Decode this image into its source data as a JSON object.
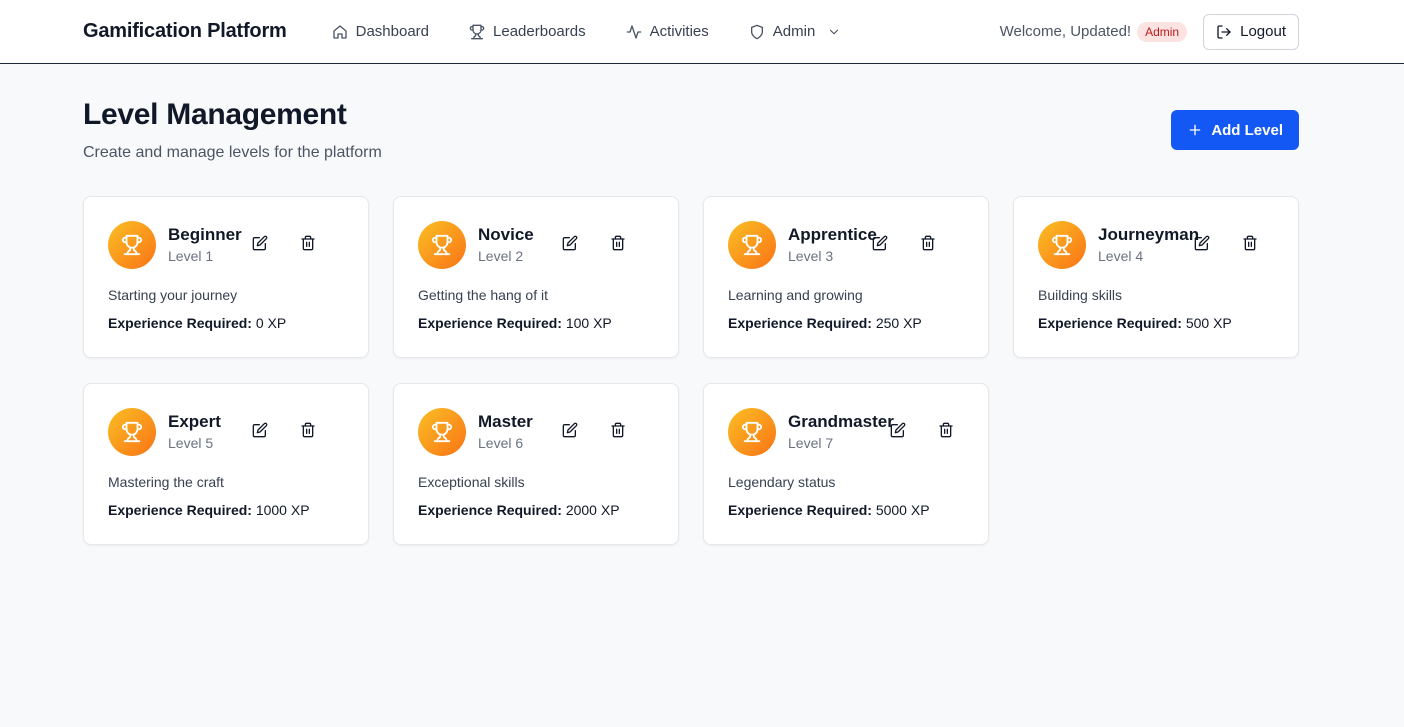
{
  "app": {
    "title": "Gamification Platform"
  },
  "nav": {
    "items": [
      {
        "label": "Dashboard",
        "icon": "home-icon"
      },
      {
        "label": "Leaderboards",
        "icon": "trophy-icon"
      },
      {
        "label": "Activities",
        "icon": "activity-icon"
      },
      {
        "label": "Admin",
        "icon": "shield-icon"
      }
    ]
  },
  "user": {
    "welcome": "Welcome, Updated!",
    "role": "Admin",
    "logout_label": "Logout"
  },
  "page": {
    "title": "Level Management",
    "subtitle": "Create and manage levels for the platform",
    "add_label": "Add Level"
  },
  "levels": [
    {
      "name": "Beginner",
      "level": "Level 1",
      "description": "Starting your journey",
      "xp_label": "Experience Required:",
      "xp": "0 XP"
    },
    {
      "name": "Novice",
      "level": "Level 2",
      "description": "Getting the hang of it",
      "xp_label": "Experience Required:",
      "xp": "100 XP"
    },
    {
      "name": "Apprentice",
      "level": "Level 3",
      "description": "Learning and growing",
      "xp_label": "Experience Required:",
      "xp": "250 XP"
    },
    {
      "name": "Journeyman",
      "level": "Level 4",
      "description": "Building skills",
      "xp_label": "Experience Required:",
      "xp": "500 XP"
    },
    {
      "name": "Expert",
      "level": "Level 5",
      "description": "Mastering the craft",
      "xp_label": "Experience Required:",
      "xp": "1000 XP"
    },
    {
      "name": "Master",
      "level": "Level 6",
      "description": "Exceptional skills",
      "xp_label": "Experience Required:",
      "xp": "2000 XP"
    },
    {
      "name": "Grandmaster",
      "level": "Level 7",
      "description": "Legendary status",
      "xp_label": "Experience Required:",
      "xp": "5000 XP"
    }
  ],
  "colors": {
    "accent": "#1358f5",
    "trophy_start": "#fbbf24",
    "trophy_end": "#f97316",
    "badge_bg": "#fde2e2",
    "badge_text": "#b91c1c"
  }
}
